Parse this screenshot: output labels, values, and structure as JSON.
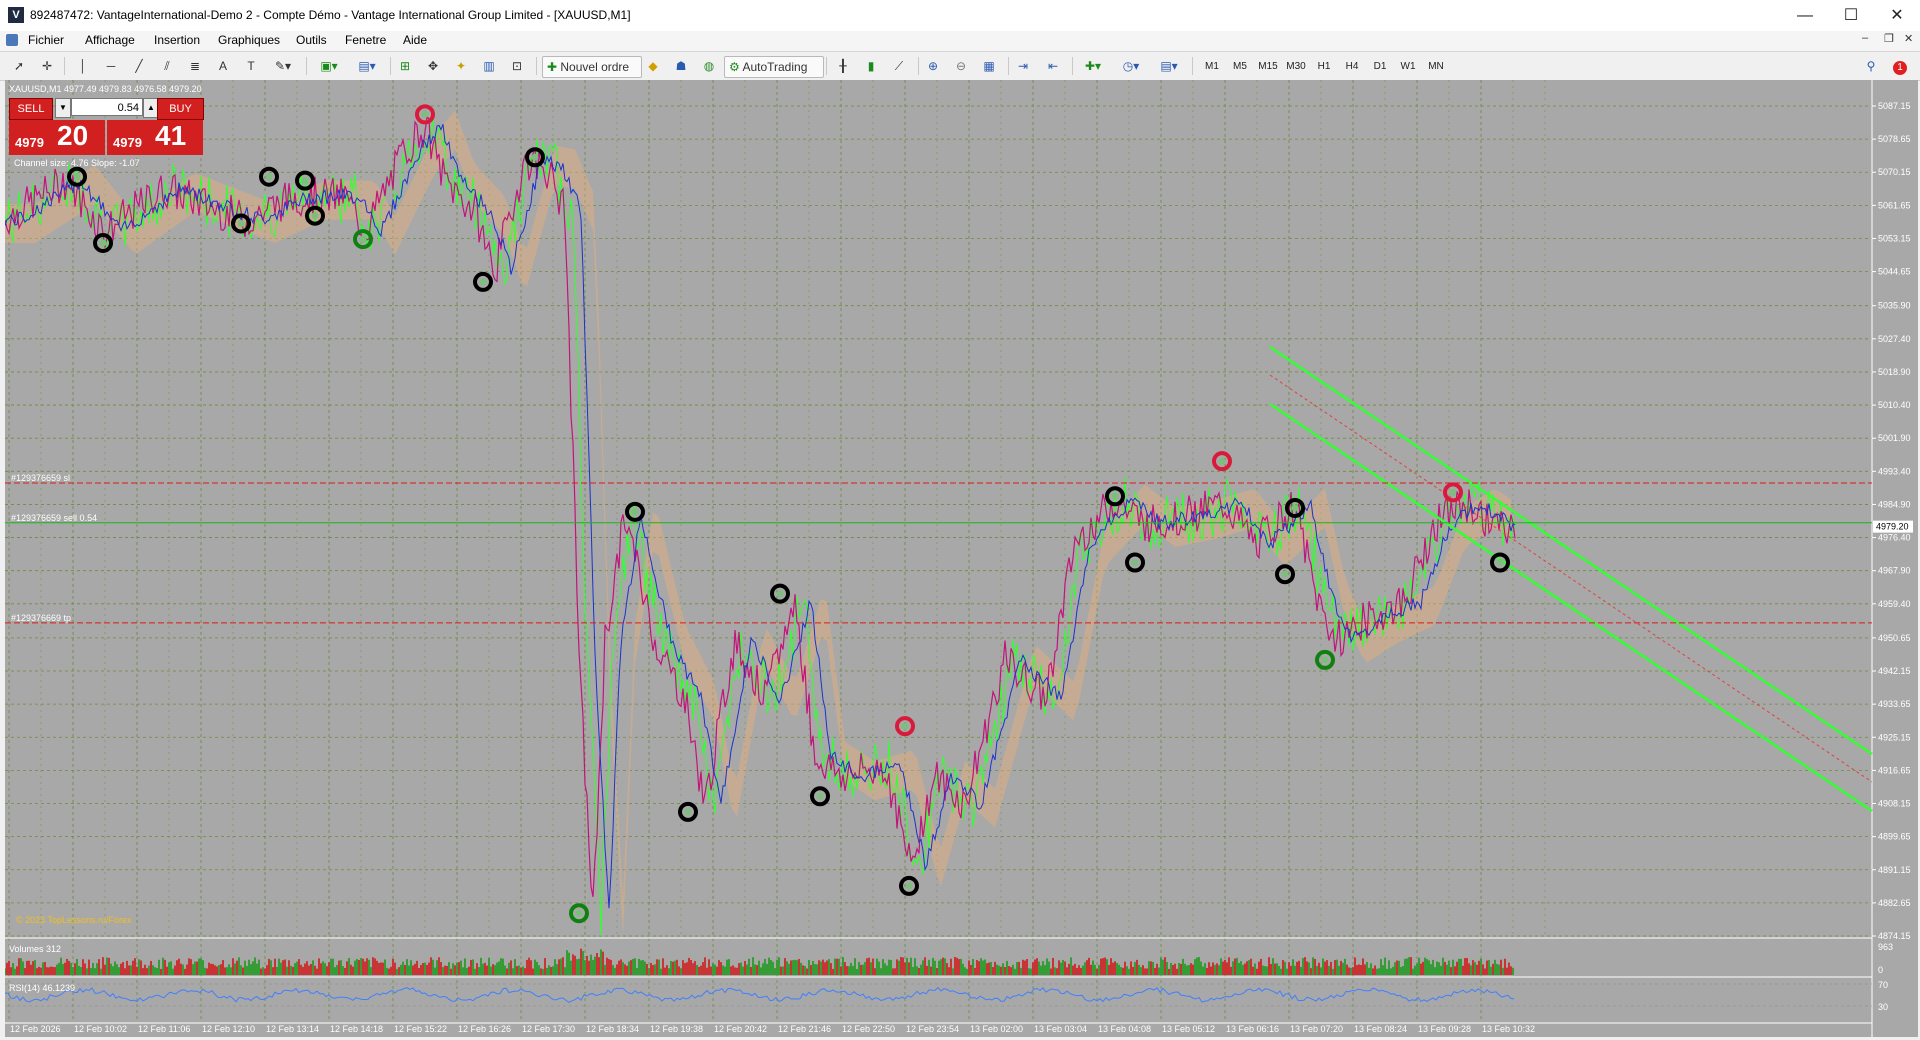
{
  "window": {
    "title": "892487472: VantageInternational-Demo 2 - Compte Démo - Vantage International Group Limited - [XAUUSD,M1]",
    "app_icon": "V",
    "minimize": "—",
    "maximize": "☐",
    "close": "✕"
  },
  "menu": {
    "items": [
      "Fichier",
      "Affichage",
      "Insertion",
      "Graphiques",
      "Outils",
      "Fenetre",
      "Aide"
    ],
    "mdi_min": "–",
    "mdi_restore": "❐",
    "mdi_close": "✕"
  },
  "toolbar": {
    "new_order": "Nouvel ordre",
    "autotrading": "AutoTrading",
    "timeframes": [
      "M1",
      "M5",
      "M15",
      "M30",
      "H1",
      "H4",
      "D1",
      "W1",
      "MN"
    ],
    "alert_badge": "1"
  },
  "chart": {
    "symbol_info": "XAUUSD,M1  4977.49 4979.83 4976.58 4979.20",
    "channel_info": "Channel size: 4.76  Slope: -1.07",
    "copyright": "© 2023 TopLessons.ru/Forex",
    "current_price": "4979.20",
    "price_levels": [
      "5087.15",
      "5078.65",
      "5070.15",
      "5061.65",
      "5053.15",
      "5044.65",
      "5035.90",
      "5027.40",
      "5018.90",
      "5010.40",
      "5001.90",
      "4993.40",
      "4984.90",
      "4976.40",
      "4967.90",
      "4959.40",
      "4950.65",
      "4942.15",
      "4933.65",
      "4925.15",
      "4916.65",
      "4908.15",
      "4899.65",
      "4891.15",
      "4882.65",
      "4874.15"
    ],
    "time_labels": [
      "12 Feb 2026",
      "12 Feb 10:02",
      "12 Feb 11:06",
      "12 Feb 12:10",
      "12 Feb 13:14",
      "12 Feb 14:18",
      "12 Feb 15:22",
      "12 Feb 16:26",
      "12 Feb 17:30",
      "12 Feb 18:34",
      "12 Feb 19:38",
      "12 Feb 20:42",
      "12 Feb 21:46",
      "12 Feb 22:50",
      "12 Feb 23:54",
      "13 Feb 02:00",
      "13 Feb 03:04",
      "13 Feb 04:08",
      "13 Feb 05:12",
      "13 Feb 06:16",
      "13 Feb 07:20",
      "13 Feb 08:24",
      "13 Feb 09:28",
      "13 Feb 10:32"
    ],
    "order_lines": [
      {
        "label": "#129376659 sl",
        "color": "#e01818",
        "price": 4990.4
      },
      {
        "label": "#129376659 sell 0.54",
        "color": "#18b818",
        "price": 4980.2
      },
      {
        "label": "#129376669 tp",
        "color": "#e01818",
        "price": 4954.5
      }
    ],
    "colors": {
      "background": "#a8a8a8",
      "grid": "#6f8a3f",
      "green_channel": "#33ff33",
      "sell_red": "#d21f1f",
      "rsi": "#3f7fff"
    }
  },
  "trade_panel": {
    "sell_label": "SELL",
    "buy_label": "BUY",
    "lot_value": "0.54",
    "sell_price_small": "4979",
    "sell_price_big": "20",
    "buy_price_small": "4979",
    "buy_price_big": "41"
  },
  "volume": {
    "label": "Volumes 312",
    "max": "963",
    "min": "0"
  },
  "rsi": {
    "label": "RSI(14) 46.1239",
    "top": "70",
    "bottom": "30"
  }
}
